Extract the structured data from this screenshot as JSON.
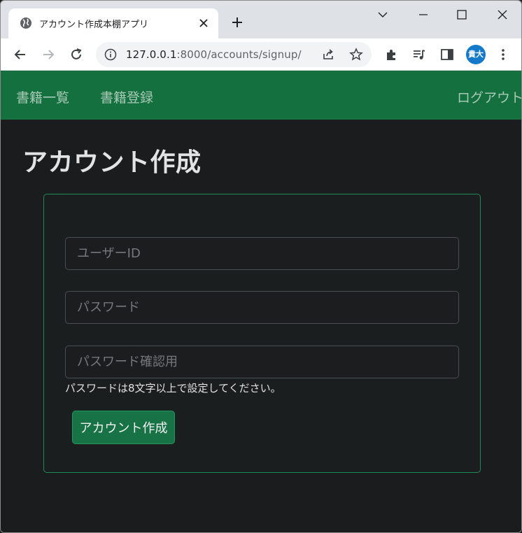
{
  "browser": {
    "tab": {
      "title": "アカウント作成本棚アプリ",
      "favicon": "globe-icon"
    },
    "address_bar": {
      "host": "127.0.0.1",
      "path": ":8000/accounts/signup/"
    },
    "profile": {
      "initials": "貴大",
      "color": "#1479c9"
    }
  },
  "navbar": {
    "color": "#157040",
    "links": [
      {
        "label": "書籍一覧"
      },
      {
        "label": "書籍登録"
      }
    ],
    "logout_label": "ログアウト"
  },
  "main": {
    "title": "アカウント作成",
    "form": {
      "username": {
        "placeholder": "ユーザーID",
        "value": ""
      },
      "password": {
        "placeholder": "パスワード",
        "value": ""
      },
      "password_confirm": {
        "placeholder": "パスワード確認用",
        "value": ""
      },
      "help_text": "パスワードは8文字以上で設定してください。",
      "submit_label": "アカウント作成",
      "border_color": "#1f8a55"
    }
  },
  "colors": {
    "background": "#1b1c1e",
    "accent": "#157040"
  }
}
